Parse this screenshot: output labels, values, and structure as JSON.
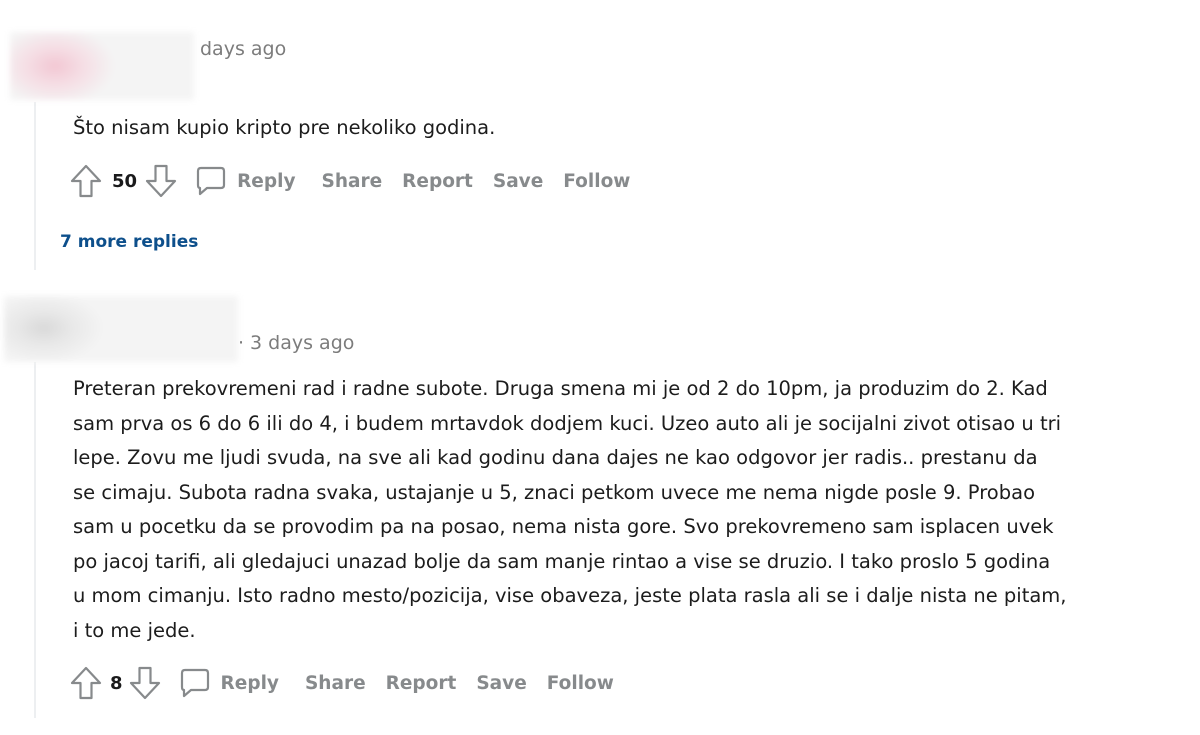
{
  "comments": [
    {
      "timestamp": "days ago",
      "body": "Što nisam kupio kripto pre nekoliko godina.",
      "score": "50",
      "actions": {
        "reply": "Reply",
        "share": "Share",
        "report": "Report",
        "save": "Save",
        "follow": "Follow"
      },
      "more_replies": "7 more replies"
    },
    {
      "separator": "·",
      "timestamp": "3 days ago",
      "body": "Preteran prekovremeni rad i radne subote. Druga smena mi je od 2 do 10pm, ja produzim do 2. Kad\nsam prva os 6 do 6 ili do 4, i budem mrtavdok dodjem kuci. Uzeo auto ali je socijalni zivot otisao u tri\nlepe. Zovu me ljudi svuda, na sve ali kad godinu dana dajes ne kao odgovor jer radis.. prestanu da\nse cimaju. Subota radna svaka, ustajanje u 5, znaci petkom uvece me nema nigde posle 9. Probao\nsam u pocetku da se provodim pa na posao, nema nista gore. Svo prekovremeno sam isplacen uvek\npo jacoj tarifi, ali gledajuci unazad bolje da sam manje rintao a vise se druzio. I tako proslo 5 godina\nu mom cimanju. Isto radno mesto/pozicija, vise obaveza, jeste plata rasla ali se i dalje nista ne pitam,\ni to me jede.",
      "score": "8",
      "actions": {
        "reply": "Reply",
        "share": "Share",
        "report": "Report",
        "save": "Save",
        "follow": "Follow"
      }
    }
  ],
  "colors": {
    "meta_text": "#7c7c7c",
    "action_text": "#878a8c",
    "link": "#0d4f8b",
    "thread_line": "#edeff1"
  },
  "icons": [
    "upvote-icon",
    "downvote-icon",
    "comment-bubble-icon"
  ]
}
